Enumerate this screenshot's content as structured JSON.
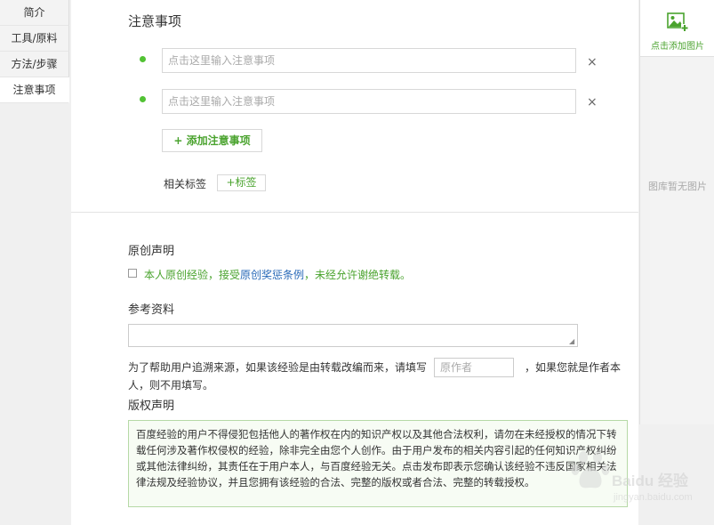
{
  "nav": {
    "items": [
      {
        "label": "简介",
        "active": false
      },
      {
        "label": "工具/原料",
        "active": false
      },
      {
        "label": "方法/步骤",
        "active": false
      },
      {
        "label": "注意事项",
        "active": true
      }
    ]
  },
  "notes": {
    "title": "注意事项",
    "placeholder": "点击这里输入注意事项",
    "close_symbol": "×",
    "add_button_label": "+ 添加注意事项",
    "tag_label": "相关标签",
    "tag_button_label": "+标签"
  },
  "original": {
    "title": "原创声明",
    "text_before": "本人原创经验，接受",
    "link_text": "原创奖惩条例",
    "text_after": "，未经允许谢绝转载。"
  },
  "reference": {
    "title": "参考资料",
    "help_line1": "为了帮助用户追溯来源，如果该经验是由转载改编而来，请填写",
    "author_placeholder": "原作者",
    "help_after": "，如果您就是作者本",
    "help_line2": "人，则不用填写。"
  },
  "copyright": {
    "title": "版权声明",
    "text": "百度经验的用户不得侵犯包括他人的著作权在内的知识产权以及其他合法权利，请勿在未经授权的情况下转载任何涉及著作权侵权的经验，除非完全由您个人创作。由于用户发布的相关内容引起的任何知识产权纠纷或其他法律纠纷，其责任在于用户本人，与百度经验无关。点击发布即表示您确认该经验不违反国家相关法律法规及经验协议，并且您拥有该经验的合法、完整的版权或者合法、完整的转载授权。"
  },
  "gallery": {
    "add_label": "点击添加图片",
    "empty_text": "图库暂无图片"
  },
  "watermark": {
    "brand": "Baidu 经验",
    "url": "jingyan.baidu.com"
  },
  "colors": {
    "accent_green": "#4aa32e",
    "link_blue": "#2a6ab8"
  }
}
